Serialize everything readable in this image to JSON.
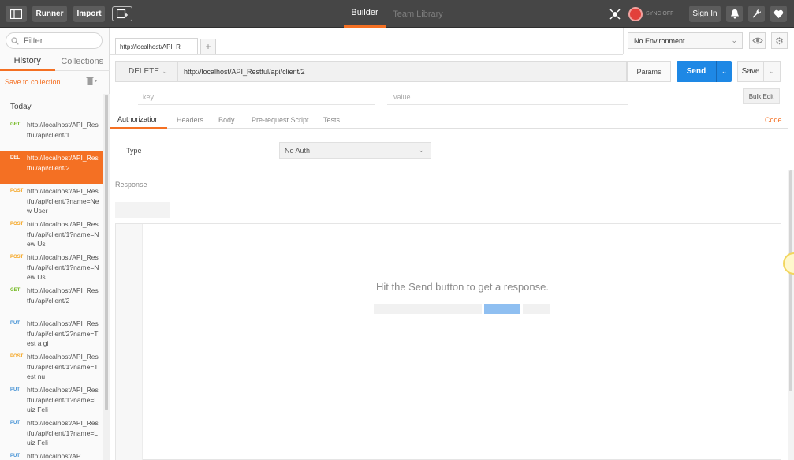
{
  "topbar": {
    "runner_label": "Runner",
    "import_label": "Import",
    "tabs": [
      {
        "label": "Builder",
        "active": true
      },
      {
        "label": "Team Library",
        "active": false
      }
    ],
    "sync_label": "SYNC OFF",
    "signin_label": "Sign In",
    "icons": [
      "sidebar-toggle-icon",
      "new-tab-icon",
      "interceptor-icon",
      "sync-icon",
      "bell-icon",
      "wrench-icon",
      "heart-icon"
    ]
  },
  "sidebar": {
    "filter_placeholder": "Filter",
    "tabs": [
      "History",
      "Collections"
    ],
    "active_tab": "History",
    "save_to_collection": "Save to collection",
    "section": "Today",
    "history": [
      {
        "method": "GET",
        "url": "http://localhost/API_Restful/api/client/1",
        "active": false
      },
      {
        "method": "DEL",
        "url": "http://localhost/API_Restful/api/client/2",
        "active": true
      },
      {
        "method": "POST",
        "url": "http://localhost/API_Restful/api/client/?name=New User",
        "active": false
      },
      {
        "method": "POST",
        "url": "http://localhost/API_Restful/api/client/1?name=New Us",
        "active": false
      },
      {
        "method": "POST",
        "url": "http://localhost/API_Restful/api/client/1?name=New Us",
        "active": false
      },
      {
        "method": "GET",
        "url": "http://localhost/API_Restful/api/client/2",
        "active": false
      },
      {
        "method": "PUT",
        "url": "http://localhost/API_Restful/api/client/2?name=Test a gi",
        "active": false
      },
      {
        "method": "POST",
        "url": "http://localhost/API_Restful/api/client/1?name=Test nu",
        "active": false
      },
      {
        "method": "PUT",
        "url": "http://localhost/API_Restful/api/client/1?name=Luiz Feli",
        "active": false
      },
      {
        "method": "PUT",
        "url": "http://localhost/API_Restful/api/client/1?name=Luiz Feli",
        "active": false
      },
      {
        "method": "PUT",
        "url": "http://localhost/AP",
        "active": false
      }
    ]
  },
  "request": {
    "tab_title": "http://localhost/API_R",
    "add_tab": "+",
    "environment": "No Environment",
    "method": "DELETE",
    "url": "http://localhost/API_Restful/api/client/2",
    "params_label": "Params",
    "send_label": "Send",
    "save_label": "Save",
    "key_placeholder": "key",
    "value_placeholder": "value",
    "bulk_edit_label": "Bulk Edit",
    "subtabs": [
      "Authorization",
      "Headers",
      "Body",
      "Pre-request Script",
      "Tests"
    ],
    "active_subtab": "Authorization",
    "code_label": "Code",
    "type_label": "Type",
    "auth_type": "No Auth"
  },
  "response": {
    "label": "Response",
    "hint": "Hit the Send button to get a response."
  },
  "colors": {
    "accent": "#f47023",
    "send": "#1e88e5",
    "get": "#75ba24",
    "post": "#f5a623",
    "put": "#3f8fd4"
  }
}
